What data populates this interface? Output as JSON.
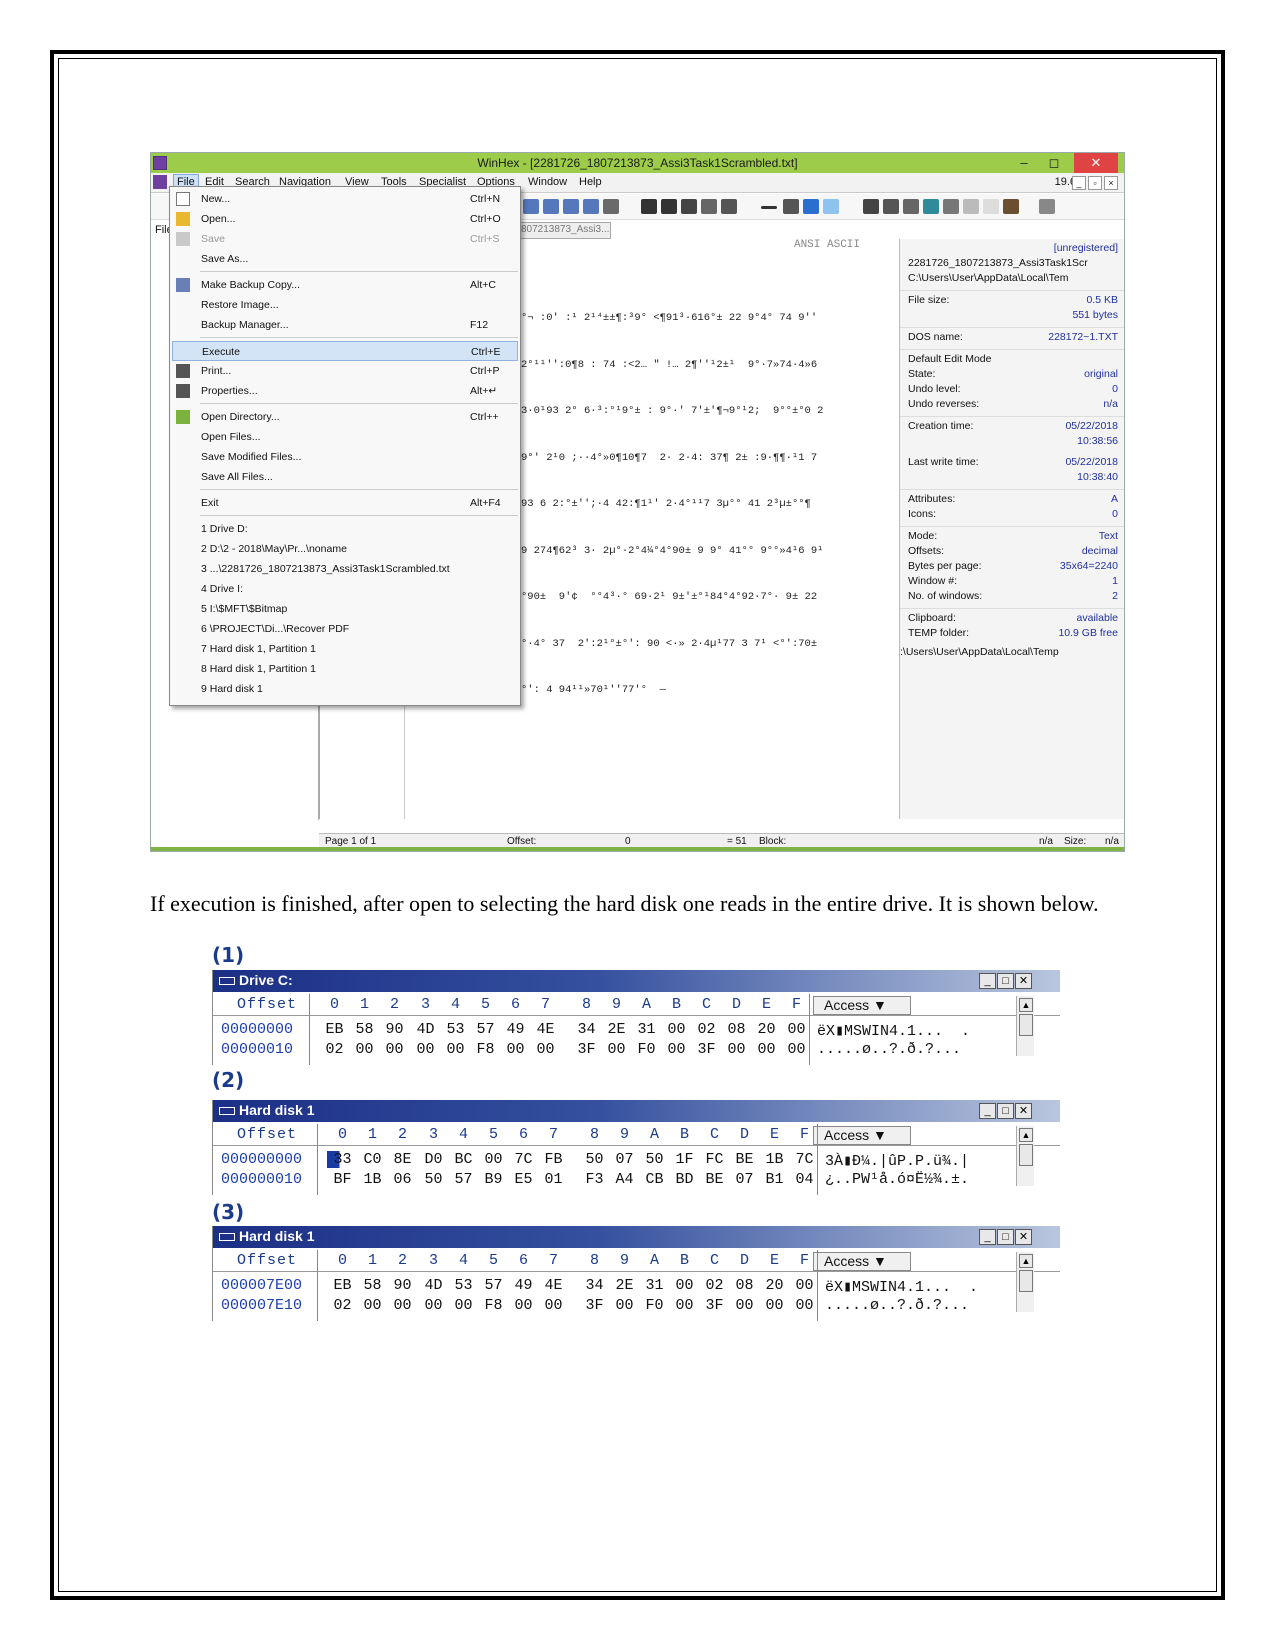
{
  "winhex": {
    "title": "WinHex - [2281726_1807213873_Assi3Task1Scrambled.txt]",
    "window_controls": [
      "–",
      "◻",
      "✕"
    ],
    "menus": [
      "File",
      "Edit",
      "Search",
      "Navigation",
      "View",
      "Tools",
      "Specialist",
      "Options",
      "Window",
      "Help"
    ],
    "version": "19.6",
    "left_pane_label": "File",
    "tab_label": "807213873_Assi3...",
    "ansi_header": "ANSI ASCII",
    "file_menu": [
      {
        "label": "New...",
        "shortcut": "Ctrl+N",
        "icon": "new-file-icon"
      },
      {
        "label": "Open...",
        "shortcut": "Ctrl+O",
        "icon": "open-folder-icon"
      },
      {
        "label": "Save",
        "shortcut": "Ctrl+S",
        "icon": "save-icon",
        "disabled": true
      },
      {
        "label": "Save As...",
        "shortcut": ""
      },
      {
        "label": "Make Backup Copy...",
        "shortcut": "Alt+C",
        "icon": "backup-icon"
      },
      {
        "label": "Restore Image...",
        "shortcut": ""
      },
      {
        "label": "Backup Manager...",
        "shortcut": "F12"
      },
      {
        "label": "Execute",
        "shortcut": "Ctrl+E",
        "highlight": true
      },
      {
        "label": "Print...",
        "shortcut": "Ctrl+P",
        "icon": "print-icon"
      },
      {
        "label": "Properties...",
        "shortcut": "Alt+↵",
        "icon": "properties-icon"
      },
      {
        "label": "Open Directory...",
        "shortcut": "Ctrl++",
        "icon": "directory-icon"
      },
      {
        "label": "Open Files...",
        "shortcut": ""
      },
      {
        "label": "Save Modified Files...",
        "shortcut": ""
      },
      {
        "label": "Save All Files...",
        "shortcut": ""
      },
      {
        "label": "Exit",
        "shortcut": "Alt+F4"
      },
      {
        "label": "1 Drive D:",
        "shortcut": ""
      },
      {
        "label": "2 D:\\2 - 2018\\May\\Pr...\\noname",
        "shortcut": ""
      },
      {
        "label": "3 ...\\2281726_1807213873_Assi3Task1Scrambled.txt",
        "shortcut": ""
      },
      {
        "label": "4 Drive I:",
        "shortcut": ""
      },
      {
        "label": "5 I:\\$MFT\\$Bitmap",
        "shortcut": ""
      },
      {
        "label": "6 \\PROJECT\\Di...\\Recover PDF",
        "shortcut": ""
      },
      {
        "label": "7 Hard disk 1, Partition 1",
        "shortcut": ""
      },
      {
        "label": "8 Hard disk 1, Partition 1",
        "shortcut": ""
      },
      {
        "label": "9 Hard disk 1",
        "shortcut": ""
      }
    ],
    "text_lines": [
      "°¬ :0' :¹ 2¹⁴±±¶:³9° <¶91³·616°± 22 9°4° 74 9''",
      "2°¹¹'':0¶8 : 74 :<2… \" !… 2¶''¹2±¹  9°·7»74·4»6",
      "3·0¹93 2° 6·³:°¹9°± : 9°·' 7'±'¶¬9°¹2;  9°°±°0 2",
      "9°' 2¹0 ;··4°»0¶10¶7  2· 2·4: 37¶ 2± :9·¶¶·¹1 7",
      "93 6 2:°±'';·4 42:¶1¹' 2·4°¹¹7 3µ°° 41 2³µ±°°¶",
      "9 274¶62³ 3· 2µ°·2°4¼°4°90± 9 9° 41°° 9°°»4¹6 9¹",
      "°90±  9'¢  °°4³·° 69·2¹ 9±'±°¹84°4°92·7°· 9± 22",
      "°·4° 37  2':2¹°±°': 90 <·» 2·4µ¹77 3 7¹ <°':70±",
      "°': 4 94¹¹»70¹''77'°  —"
    ],
    "info": {
      "header": "[unregistered]",
      "file_name": "2281726_1807213873_Assi3Task1Scr",
      "path": "C:\\Users\\User\\AppData\\Local\\Tem",
      "rows_a": [
        {
          "k": "File size:",
          "v": "0.5 KB"
        },
        {
          "k": "",
          "v": "551 bytes"
        }
      ],
      "rows_b": [
        {
          "k": "DOS name:",
          "v": "228172~1.TXT"
        }
      ],
      "rows_c": [
        {
          "k": "Default Edit Mode",
          "v": ""
        },
        {
          "k": "State:",
          "v": "original"
        },
        {
          "k": "Undo level:",
          "v": "0"
        },
        {
          "k": "Undo reverses:",
          "v": "n/a"
        }
      ],
      "rows_d": [
        {
          "k": "Creation time:",
          "v": "05/22/2018"
        },
        {
          "k": "",
          "v": "10:38:56"
        },
        {
          "k": "",
          "v": ""
        },
        {
          "k": "Last write time:",
          "v": "05/22/2018"
        },
        {
          "k": "",
          "v": "10:38:40"
        }
      ],
      "rows_e": [
        {
          "k": "Attributes:",
          "v": "A"
        },
        {
          "k": "Icons:",
          "v": "0"
        }
      ],
      "rows_f": [
        {
          "k": "Mode:",
          "v": "Text"
        },
        {
          "k": "Offsets:",
          "v": "decimal"
        },
        {
          "k": "Bytes per page:",
          "v": "35x64=2240"
        },
        {
          "k": "Window #:",
          "v": "1"
        },
        {
          "k": "No. of windows:",
          "v": "2"
        }
      ],
      "rows_g": [
        {
          "k": "Clipboard:",
          "v": "available"
        },
        {
          "k": "TEMP folder:",
          "v": "10.9 GB free"
        }
      ],
      "temp_path": ":\\Users\\User\\AppData\\Local\\Temp"
    },
    "status": {
      "page": "Page 1 of 1",
      "offset_label": "Offset:",
      "offset_value": "0",
      "eq": "= 51",
      "block_label": "Block:",
      "na1": "n/a",
      "size_label": "Size:",
      "na2": "n/a"
    }
  },
  "paragraph": "If execution is finished, after open to selecting the hard disk one reads in the entire drive. It is shown below.",
  "hex_windows": [
    {
      "label": "(1)",
      "title": "Drive C:",
      "offset_header": "Offset",
      "columns": [
        "0",
        "1",
        "2",
        "3",
        "4",
        "5",
        "6",
        "7",
        "8",
        "9",
        "A",
        "B",
        "C",
        "D",
        "E",
        "F"
      ],
      "access": "Access ▼",
      "rows": [
        {
          "offset": "00000000",
          "bytes": [
            "EB",
            "58",
            "90",
            "4D",
            "53",
            "57",
            "49",
            "4E",
            "34",
            "2E",
            "31",
            "00",
            "02",
            "08",
            "20",
            "00"
          ],
          "ascii": "ëX▮MSWIN4.1...  ."
        },
        {
          "offset": "00000010",
          "bytes": [
            "02",
            "00",
            "00",
            "00",
            "00",
            "F8",
            "00",
            "00",
            "3F",
            "00",
            "F0",
            "00",
            "3F",
            "00",
            "00",
            "00"
          ],
          "ascii": ".....ø..?.ð.?..."
        }
      ]
    },
    {
      "label": "(2)",
      "title": "Hard disk 1",
      "offset_header": "Offset",
      "columns": [
        "0",
        "1",
        "2",
        "3",
        "4",
        "5",
        "6",
        "7",
        "8",
        "9",
        "A",
        "B",
        "C",
        "D",
        "E",
        "F"
      ],
      "access": "Access ▼",
      "rows": [
        {
          "offset": "000000000",
          "bytes": [
            "33",
            "C0",
            "8E",
            "D0",
            "BC",
            "00",
            "7C",
            "FB",
            "50",
            "07",
            "50",
            "1F",
            "FC",
            "BE",
            "1B",
            "7C"
          ],
          "ascii": "3À▮Ð¼.|ûP.P.ü¾.|"
        },
        {
          "offset": "000000010",
          "bytes": [
            "BF",
            "1B",
            "06",
            "50",
            "57",
            "B9",
            "E5",
            "01",
            "F3",
            "A4",
            "CB",
            "BD",
            "BE",
            "07",
            "B1",
            "04"
          ],
          "ascii": "¿..PW¹å.ó¤Ë½¾.±."
        }
      ]
    },
    {
      "label": "(3)",
      "title": "Hard disk 1",
      "offset_header": "Offset",
      "columns": [
        "0",
        "1",
        "2",
        "3",
        "4",
        "5",
        "6",
        "7",
        "8",
        "9",
        "A",
        "B",
        "C",
        "D",
        "E",
        "F"
      ],
      "access": "Access ▼",
      "rows": [
        {
          "offset": "000007E00",
          "bytes": [
            "EB",
            "58",
            "90",
            "4D",
            "53",
            "57",
            "49",
            "4E",
            "34",
            "2E",
            "31",
            "00",
            "02",
            "08",
            "20",
            "00"
          ],
          "ascii": "ëX▮MSWIN4.1...  ."
        },
        {
          "offset": "000007E10",
          "bytes": [
            "02",
            "00",
            "00",
            "00",
            "00",
            "F8",
            "00",
            "00",
            "3F",
            "00",
            "F0",
            "00",
            "3F",
            "00",
            "00",
            "00"
          ],
          "ascii": ".....ø..?.ð.?..."
        }
      ]
    }
  ]
}
